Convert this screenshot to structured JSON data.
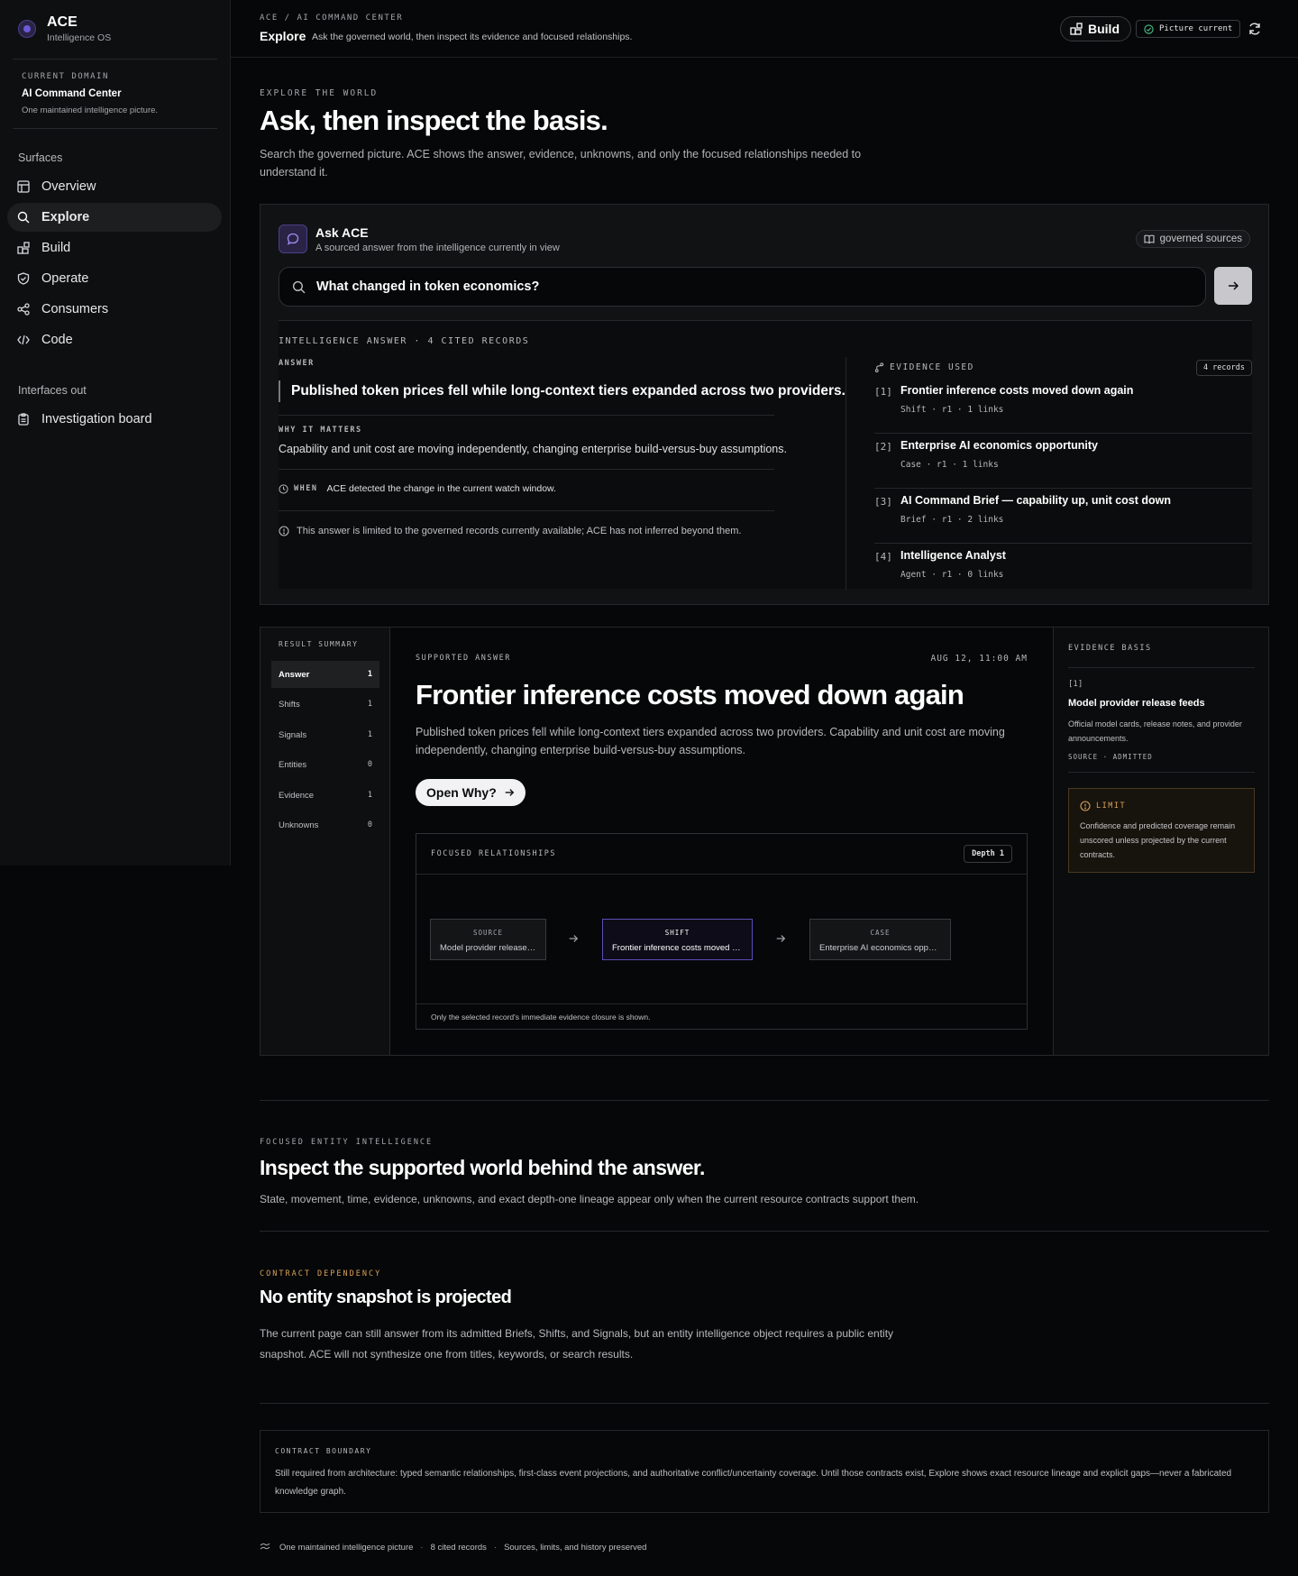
{
  "sidebar": {
    "brand_name": "ACE",
    "brand_sub": "Intelligence OS",
    "domain_label": "CURRENT DOMAIN",
    "domain_name": "AI Command Center",
    "domain_sub": "One maintained intelligence picture.",
    "surfaces_label": "Surfaces",
    "items": [
      {
        "label": "Overview",
        "icon": "layout-icon"
      },
      {
        "label": "Explore",
        "icon": "search-icon",
        "active": true
      },
      {
        "label": "Build",
        "icon": "blocks-icon"
      },
      {
        "label": "Operate",
        "icon": "shield-icon"
      },
      {
        "label": "Consumers",
        "icon": "share-icon"
      },
      {
        "label": "Code",
        "icon": "code-icon"
      }
    ],
    "interfaces_label": "Interfaces out",
    "interfaces": [
      {
        "label": "Investigation board",
        "icon": "clipboard-icon"
      }
    ]
  },
  "header": {
    "breadcrumb": "ACE / AI COMMAND CENTER",
    "title": "Explore",
    "subtitle": "Ask the governed world, then inspect its evidence and focused relationships.",
    "build_label": "Build",
    "status_label": "Picture current"
  },
  "hero": {
    "eyebrow": "EXPLORE THE WORLD",
    "title": "Ask, then inspect the basis.",
    "subtitle_line1": "Search the governed picture. ACE shows the answer, evidence, unknowns, and only the focused relationships needed to",
    "subtitle_line2": "understand it."
  },
  "ask": {
    "title": "Ask ACE",
    "subtitle": "A sourced answer from the intelligence currently in view",
    "chip": "governed sources",
    "query": "What changed in token economics?",
    "answer_head": "INTELLIGENCE ANSWER · 4 CITED RECORDS",
    "answer_label": "ANSWER",
    "answer_text": "Published token prices fell while long-context tiers expanded across two providers.",
    "why_label": "WHY IT MATTERS",
    "why_text": "Capability and unit cost are moving independently, changing enterprise build-versus-buy assumptions.",
    "when_label": "WHEN",
    "when_text": "ACE detected the change in the current watch window.",
    "limit_text": "This answer is limited to the governed records currently available; ACE has not inferred beyond them.",
    "evidence_label": "EVIDENCE USED",
    "evidence_count": "4 records",
    "evidence": [
      {
        "num": "[1]",
        "title": "Frontier inference costs moved down again",
        "meta": "Shift · r1 · 1 links"
      },
      {
        "num": "[2]",
        "title": "Enterprise AI economics opportunity",
        "meta": "Case · r1 · 1 links"
      },
      {
        "num": "[3]",
        "title": "AI Command Brief — capability up, unit cost down",
        "meta": "Brief · r1 · 2 links"
      },
      {
        "num": "[4]",
        "title": "Intelligence Analyst",
        "meta": "Agent · r1 · 0 links"
      }
    ]
  },
  "result": {
    "summary_label": "RESULT SUMMARY",
    "summary": [
      {
        "label": "Answer",
        "count": "1",
        "active": true
      },
      {
        "label": "Shifts",
        "count": "1"
      },
      {
        "label": "Signals",
        "count": "1"
      },
      {
        "label": "Entities",
        "count": "0"
      },
      {
        "label": "Evidence",
        "count": "1"
      },
      {
        "label": "Unknowns",
        "count": "0"
      }
    ],
    "supported_label": "SUPPORTED ANSWER",
    "date": "AUG 12, 11:00 AM",
    "title": "Frontier inference costs moved down again",
    "body": "Published token prices fell while long-context tiers expanded across two providers. Capability and unit cost are moving independently, changing enterprise build-versus-buy assumptions.",
    "why_button": "Open Why?",
    "relationships_label": "FOCUSED RELATIONSHIPS",
    "depth": "Depth 1",
    "nodes": [
      {
        "type": "SOURCE",
        "label": "Model provider release feeds"
      },
      {
        "type": "SHIFT",
        "label": "Frontier inference costs moved down again"
      },
      {
        "type": "CASE",
        "label": "Enterprise AI economics opportunity"
      }
    ],
    "relationships_foot": "Only the selected record's immediate evidence closure is shown.",
    "basis_label": "EVIDENCE BASIS",
    "basis_num": "[1]",
    "basis_title": "Model provider release feeds",
    "basis_desc": "Official model cards, release notes, and provider announcements.",
    "basis_meta": "SOURCE · ADMITTED",
    "limit_label": "LIMIT",
    "limit_text": "Confidence and predicted coverage remain unscored unless projected by the current contracts."
  },
  "entity": {
    "eyebrow": "FOCUSED ENTITY INTELLIGENCE",
    "title": "Inspect the supported world behind the answer.",
    "text": "State, movement, time, evidence, unknowns, and exact depth-one lineage appear only when the current resource contracts support them."
  },
  "contract": {
    "eyebrow": "CONTRACT DEPENDENCY",
    "title": "No entity snapshot is projected",
    "text_line1": "The current page can still answer from its admitted Briefs, Shifts, and Signals, but an entity intelligence object requires a public entity",
    "text_line2": "snapshot. ACE will not synthesize one from titles, keywords, or search results."
  },
  "boundary": {
    "title": "CONTRACT BOUNDARY",
    "body": "Still required from architecture: typed semantic relationships, first-class event projections, and authoritative conflict/uncertainty coverage. Until those contracts exist, Explore shows exact resource lineage and explicit gaps—never a fabricated knowledge graph."
  },
  "footer": {
    "items": [
      "One maintained intelligence picture",
      "8 cited records",
      "Sources, limits, and history preserved"
    ]
  },
  "colors": {
    "background": "#060708",
    "panel": "#111214",
    "accent_purple": "#6b5bd6",
    "amber": "#d9a05a"
  }
}
